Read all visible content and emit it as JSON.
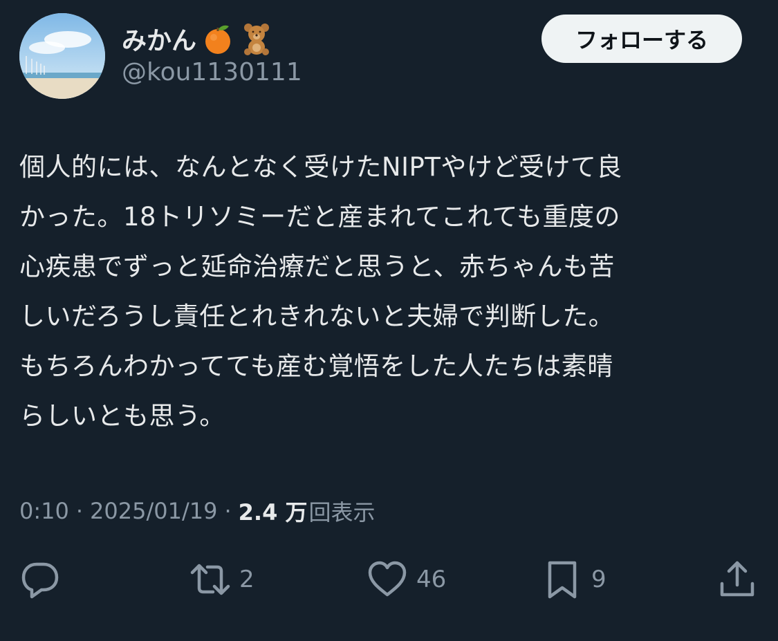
{
  "user": {
    "display_name": "みかん",
    "emojis": [
      "tangerine-emoji",
      "teddy-bear-emoji"
    ],
    "handle": "@kou1130111"
  },
  "follow_button": {
    "label": "フォローする"
  },
  "post": {
    "lines": [
      "個人的には、なんとなく受けたNIPTやけど受けて良",
      "かった。18トリソミーだと産まれてこれても重度の",
      "心疾患でずっと延命治療だと思うと、赤ちゃんも苦",
      "しいだろうし責任とれきれないと夫婦で判断した。",
      "もちろんわかってても産む覚悟をした人たちは素晴",
      "らしいとも思う。"
    ]
  },
  "meta": {
    "time": "0:10",
    "date": "2025/01/19",
    "separator": "·",
    "views_count": "2.4 万",
    "views_label": "回表示"
  },
  "actions": {
    "reply_count": "",
    "repost_count": "2",
    "like_count": "46",
    "bookmark_count": "9"
  },
  "colors": {
    "background": "#15202b",
    "text": "#e7e9ea",
    "secondary_text": "#8b98a5",
    "button_bg": "#eff3f4"
  }
}
